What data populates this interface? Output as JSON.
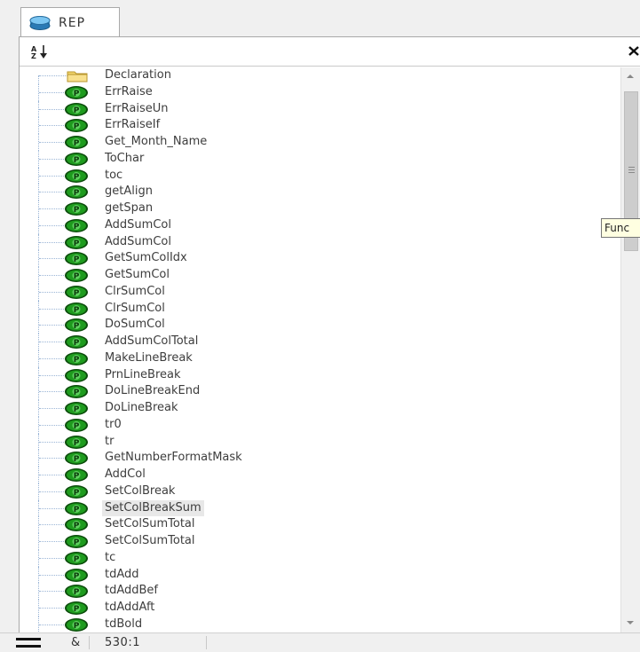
{
  "tab": {
    "label": "REP"
  },
  "toolbar": {
    "sort_icon": "sort-az-icon",
    "close_icon": "close-icon"
  },
  "tree": {
    "items": [
      {
        "label": "Declaration",
        "icon": "folder-icon",
        "selected": false
      },
      {
        "label": "ErrRaise",
        "icon": "function-icon",
        "selected": false
      },
      {
        "label": "ErrRaiseUn",
        "icon": "function-icon",
        "selected": false
      },
      {
        "label": "ErrRaiseIf",
        "icon": "function-icon",
        "selected": false
      },
      {
        "label": "Get_Month_Name",
        "icon": "function-icon",
        "selected": false
      },
      {
        "label": "ToChar",
        "icon": "function-icon",
        "selected": false
      },
      {
        "label": "toc",
        "icon": "function-icon",
        "selected": false
      },
      {
        "label": "getAlign",
        "icon": "function-icon",
        "selected": false
      },
      {
        "label": "getSpan",
        "icon": "function-icon",
        "selected": false
      },
      {
        "label": "AddSumCol",
        "icon": "function-icon",
        "selected": false
      },
      {
        "label": "AddSumCol",
        "icon": "function-icon",
        "selected": false
      },
      {
        "label": "GetSumColIdx",
        "icon": "function-icon",
        "selected": false
      },
      {
        "label": "GetSumCol",
        "icon": "function-icon",
        "selected": false
      },
      {
        "label": "ClrSumCol",
        "icon": "function-icon",
        "selected": false
      },
      {
        "label": "ClrSumCol",
        "icon": "function-icon",
        "selected": false
      },
      {
        "label": "DoSumCol",
        "icon": "function-icon",
        "selected": false
      },
      {
        "label": "AddSumColTotal",
        "icon": "function-icon",
        "selected": false
      },
      {
        "label": "MakeLineBreak",
        "icon": "function-icon",
        "selected": false
      },
      {
        "label": "PrnLineBreak",
        "icon": "function-icon",
        "selected": false
      },
      {
        "label": "DoLineBreakEnd",
        "icon": "function-icon",
        "selected": false
      },
      {
        "label": "DoLineBreak",
        "icon": "function-icon",
        "selected": false
      },
      {
        "label": "tr0",
        "icon": "function-icon",
        "selected": false
      },
      {
        "label": "tr",
        "icon": "function-icon",
        "selected": false
      },
      {
        "label": "GetNumberFormatMask",
        "icon": "function-icon",
        "selected": false
      },
      {
        "label": "AddCol",
        "icon": "function-icon",
        "selected": false
      },
      {
        "label": "SetColBreak",
        "icon": "function-icon",
        "selected": false
      },
      {
        "label": "SetColBreakSum",
        "icon": "function-icon",
        "selected": true
      },
      {
        "label": "SetColSumTotal",
        "icon": "function-icon",
        "selected": false
      },
      {
        "label": "SetColSumTotal",
        "icon": "function-icon",
        "selected": false
      },
      {
        "label": "tc",
        "icon": "function-icon",
        "selected": false
      },
      {
        "label": "tdAdd",
        "icon": "function-icon",
        "selected": false
      },
      {
        "label": "tdAddBef",
        "icon": "function-icon",
        "selected": false
      },
      {
        "label": "tdAddAft",
        "icon": "function-icon",
        "selected": false
      },
      {
        "label": "tdBold",
        "icon": "function-icon",
        "selected": false
      }
    ]
  },
  "tooltip": {
    "text": "Func"
  },
  "status": {
    "mode": "&",
    "position": "530:1"
  },
  "colors": {
    "function_icon": "#1e9b1e",
    "folder_icon": "#f2d46b",
    "tree_line": "#9bb5d6",
    "selected_bg": "#e8e8e8"
  }
}
